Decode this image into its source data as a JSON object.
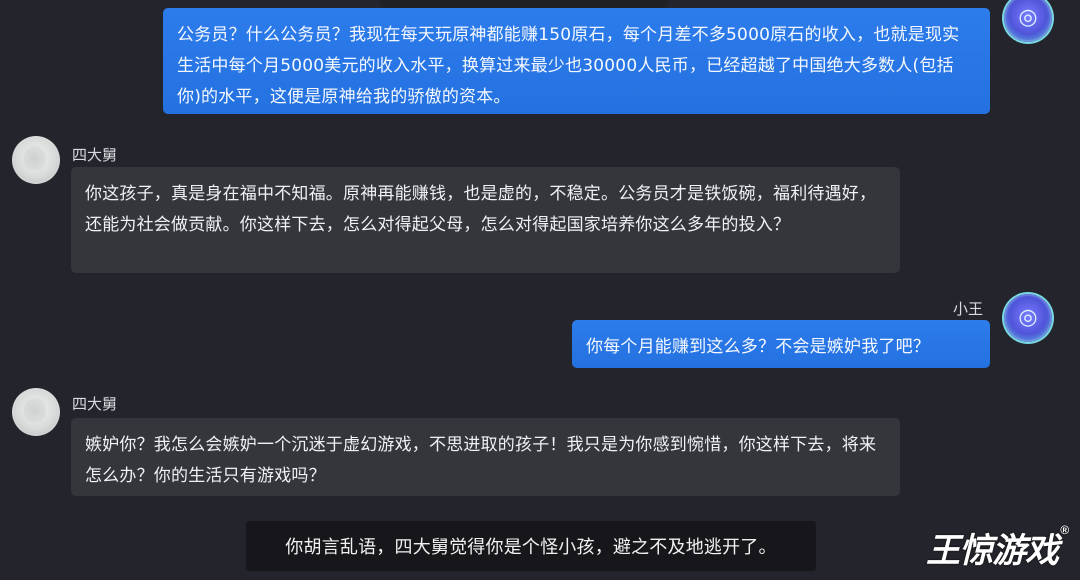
{
  "chat": {
    "messages": [
      {
        "sender": "小王",
        "side": "right",
        "text": "公务员？什么公务员？我现在每天玩原神都能赚150原石，每个月差不多5000原石的收入，也就是现实生活中每个月5000美元的收入水平，换算过来最少也30000人民币，已经超越了中国绝大多数人(包括你)的水平，这便是原神给我的骄傲的资本。"
      },
      {
        "sender": "四大舅",
        "side": "left",
        "text": "你这孩子，真是身在福中不知福。原神再能赚钱，也是虚的，不稳定。公务员才是铁饭碗，福利待遇好，还能为社会做贡献。你这样下去，怎么对得起父母，怎么对得起国家培养你这么多年的投入？"
      },
      {
        "sender": "小王",
        "side": "right",
        "text": "你每个月能赚到这么多？不会是嫉妒我了吧？"
      },
      {
        "sender": "四大舅",
        "side": "left",
        "text": "嫉妒你？我怎么会嫉妒一个沉迷于虚幻游戏，不思进取的孩子！我只是为你感到惋惜，你这样下去，将来怎么办？你的生活只有游戏吗？"
      }
    ],
    "names": {
      "uncle": "四大舅",
      "xiaowang": "小王"
    },
    "notice": "你胡言乱语，四大舅觉得你是个怪小孩，避之不及地逃开了。",
    "watermark": "王惊游戏",
    "watermark_mark": "®",
    "avatar_icons": {
      "xiaowang": "spiral-emblem-icon",
      "uncle": "blur-avatar-icon"
    }
  }
}
